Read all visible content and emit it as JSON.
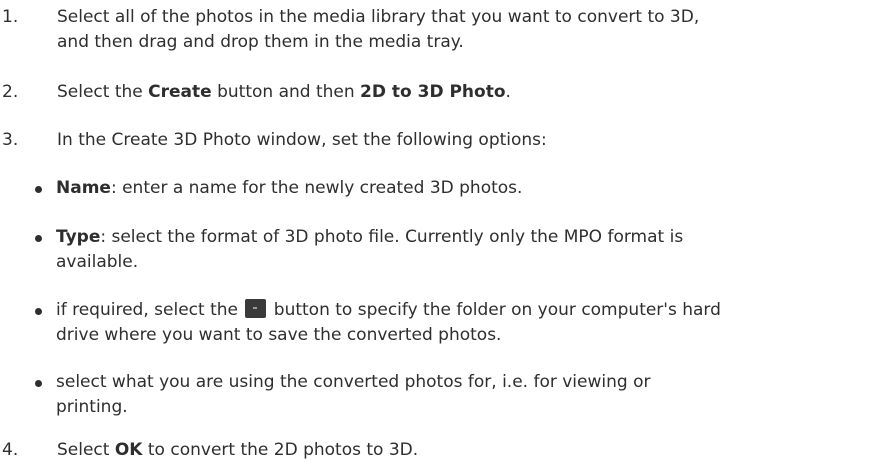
{
  "steps": [
    {
      "num": "1.",
      "lines": [
        "Select all of the photos in the media library that you want to convert to 3D,",
        "and then drag and drop them in the media tray."
      ]
    },
    {
      "num": "2.",
      "pre": "Select the ",
      "b1": "Create",
      "mid": " button and then ",
      "b2": "2D to 3D Photo",
      "post": "."
    },
    {
      "num": "3.",
      "text": "In the Create 3D Photo window, set the following options:"
    },
    {
      "num": "4.",
      "pre": "Select ",
      "b1": "OK",
      "post": " to convert the 2D photos to 3D."
    }
  ],
  "options": [
    {
      "label": "Name",
      "text": ": enter a name for the newly created 3D photos."
    },
    {
      "label": "Type",
      "line1": ": select the format of 3D photo file. Currently only the MPO format is",
      "line2": "available."
    },
    {
      "pre": "if required, select the ",
      "post": " button to specify the folder on your computer's hard",
      "line2": "drive where you want to save the converted photos.",
      "icon": "folder-browse-icon"
    },
    {
      "line1": "select what you are using the converted photos for, i.e. for viewing or",
      "line2": "printing."
    }
  ]
}
